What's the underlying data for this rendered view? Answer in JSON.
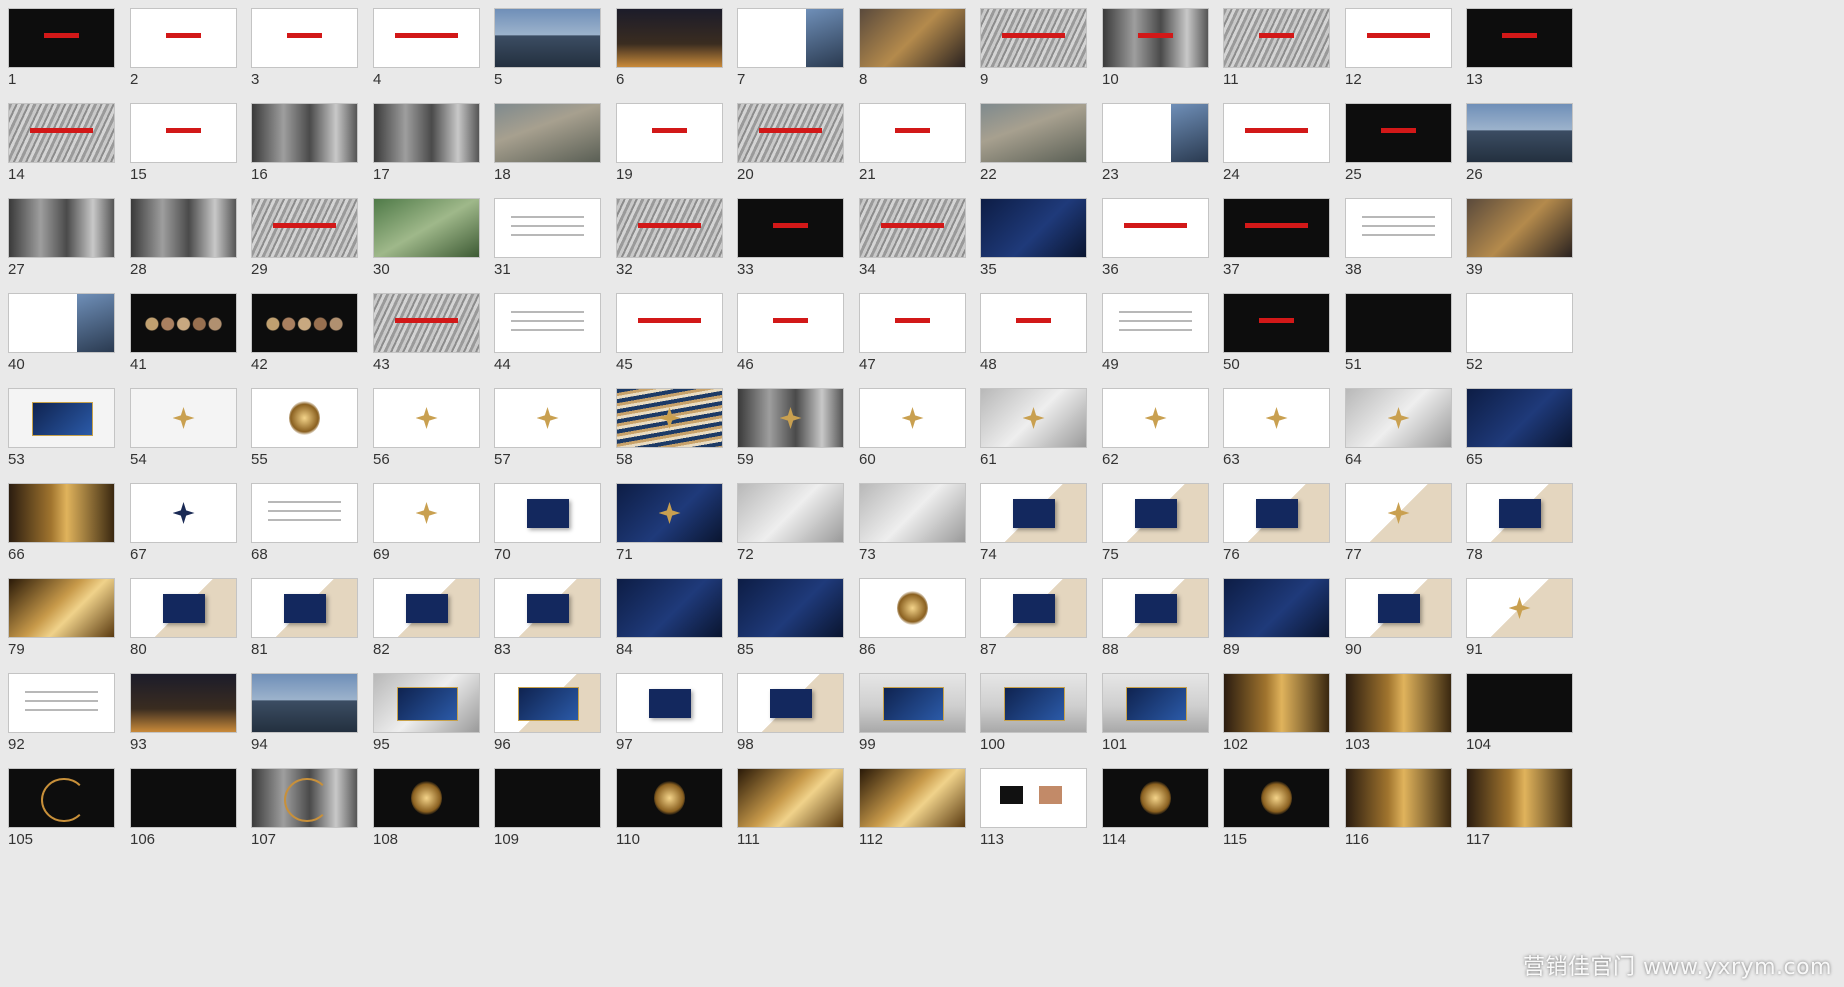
{
  "watermark": "营销佳官门 www.yxrym.com",
  "slides": [
    {
      "number": "1",
      "style": "black",
      "overlay": "redtext small"
    },
    {
      "number": "2",
      "style": "white",
      "overlay": "redtext small"
    },
    {
      "number": "3",
      "style": "white",
      "overlay": "redtext small"
    },
    {
      "number": "4",
      "style": "white",
      "overlay": "redtext"
    },
    {
      "number": "5",
      "style": "city",
      "overlay": ""
    },
    {
      "number": "6",
      "style": "night",
      "overlay": ""
    },
    {
      "number": "7",
      "style": "white",
      "overlay": "sidephoto"
    },
    {
      "number": "8",
      "style": "street",
      "overlay": ""
    },
    {
      "number": "9",
      "style": "marble",
      "overlay": "redtext"
    },
    {
      "number": "10",
      "style": "photo-bw",
      "overlay": "redtext small"
    },
    {
      "number": "11",
      "style": "marble",
      "overlay": "redtext small"
    },
    {
      "number": "12",
      "style": "white",
      "overlay": "redtext"
    },
    {
      "number": "13",
      "style": "black",
      "overlay": "redtext small"
    },
    {
      "number": "14",
      "style": "marble",
      "overlay": "redtext"
    },
    {
      "number": "15",
      "style": "white",
      "overlay": "redtext small"
    },
    {
      "number": "16",
      "style": "photo-bw",
      "overlay": ""
    },
    {
      "number": "17",
      "style": "photo-bw",
      "overlay": ""
    },
    {
      "number": "18",
      "style": "aerial",
      "overlay": ""
    },
    {
      "number": "19",
      "style": "white",
      "overlay": "redtext small"
    },
    {
      "number": "20",
      "style": "marble",
      "overlay": "redtext"
    },
    {
      "number": "21",
      "style": "white",
      "overlay": "redtext small"
    },
    {
      "number": "22",
      "style": "aerial",
      "overlay": ""
    },
    {
      "number": "23",
      "style": "white",
      "overlay": "sidephoto"
    },
    {
      "number": "24",
      "style": "white",
      "overlay": "redtext"
    },
    {
      "number": "25",
      "style": "black",
      "overlay": "redtext small"
    },
    {
      "number": "26",
      "style": "city",
      "overlay": ""
    },
    {
      "number": "27",
      "style": "photo-bw",
      "overlay": ""
    },
    {
      "number": "28",
      "style": "photo-bw",
      "overlay": ""
    },
    {
      "number": "29",
      "style": "marble",
      "overlay": "redtext"
    },
    {
      "number": "30",
      "style": "green",
      "overlay": ""
    },
    {
      "number": "31",
      "style": "white",
      "overlay": "bar"
    },
    {
      "number": "32",
      "style": "marble",
      "overlay": "redtext"
    },
    {
      "number": "33",
      "style": "black",
      "overlay": "redtext small"
    },
    {
      "number": "34",
      "style": "marble",
      "overlay": "redtext"
    },
    {
      "number": "35",
      "style": "navy",
      "overlay": ""
    },
    {
      "number": "36",
      "style": "white",
      "overlay": "redtext"
    },
    {
      "number": "37",
      "style": "black",
      "overlay": "redtext"
    },
    {
      "number": "38",
      "style": "white",
      "overlay": "bar"
    },
    {
      "number": "39",
      "style": "street",
      "overlay": ""
    },
    {
      "number": "40",
      "style": "white",
      "overlay": "sidephoto"
    },
    {
      "number": "41",
      "style": "black",
      "overlay": "circles"
    },
    {
      "number": "42",
      "style": "black",
      "overlay": "circles"
    },
    {
      "number": "43",
      "style": "marble",
      "overlay": "redtext"
    },
    {
      "number": "44",
      "style": "white",
      "overlay": "bar"
    },
    {
      "number": "45",
      "style": "white",
      "overlay": "redtext"
    },
    {
      "number": "46",
      "style": "white",
      "overlay": "redtext small"
    },
    {
      "number": "47",
      "style": "white",
      "overlay": "redtext small"
    },
    {
      "number": "48",
      "style": "white",
      "overlay": "redtext small"
    },
    {
      "number": "49",
      "style": "white",
      "overlay": "bar"
    },
    {
      "number": "50",
      "style": "black",
      "overlay": "redtext small"
    },
    {
      "number": "51",
      "style": "black",
      "overlay": ""
    },
    {
      "number": "52",
      "style": "white",
      "overlay": ""
    },
    {
      "number": "53",
      "style": "lightgrey",
      "overlay": "panel"
    },
    {
      "number": "54",
      "style": "lightgrey",
      "overlay": "star"
    },
    {
      "number": "55",
      "style": "white",
      "overlay": "gold-glow"
    },
    {
      "number": "56",
      "style": "white",
      "overlay": "star"
    },
    {
      "number": "57",
      "style": "white",
      "overlay": "star"
    },
    {
      "number": "58",
      "style": "waves",
      "overlay": "star"
    },
    {
      "number": "59",
      "style": "photo-bw",
      "overlay": "star"
    },
    {
      "number": "60",
      "style": "white",
      "overlay": "star"
    },
    {
      "number": "61",
      "style": "silver",
      "overlay": "star"
    },
    {
      "number": "62",
      "style": "white",
      "overlay": "star"
    },
    {
      "number": "63",
      "style": "white",
      "overlay": "star"
    },
    {
      "number": "64",
      "style": "silver",
      "overlay": "star"
    },
    {
      "number": "65",
      "style": "navy",
      "overlay": ""
    },
    {
      "number": "66",
      "style": "interior",
      "overlay": ""
    },
    {
      "number": "67",
      "style": "white",
      "overlay": "star dark"
    },
    {
      "number": "68",
      "style": "white",
      "overlay": "bar"
    },
    {
      "number": "69",
      "style": "white",
      "overlay": "star"
    },
    {
      "number": "70",
      "style": "white",
      "overlay": "card"
    },
    {
      "number": "71",
      "style": "navy",
      "overlay": "star"
    },
    {
      "number": "72",
      "style": "silver",
      "overlay": ""
    },
    {
      "number": "73",
      "style": "silver",
      "overlay": ""
    },
    {
      "number": "74",
      "style": "beige",
      "overlay": "card"
    },
    {
      "number": "75",
      "style": "beige",
      "overlay": "card"
    },
    {
      "number": "76",
      "style": "beige",
      "overlay": "card"
    },
    {
      "number": "77",
      "style": "beige",
      "overlay": "star"
    },
    {
      "number": "78",
      "style": "beige",
      "overlay": "card"
    },
    {
      "number": "79",
      "style": "gold",
      "overlay": ""
    },
    {
      "number": "80",
      "style": "beige",
      "overlay": "card"
    },
    {
      "number": "81",
      "style": "beige",
      "overlay": "card"
    },
    {
      "number": "82",
      "style": "beige",
      "overlay": "card"
    },
    {
      "number": "83",
      "style": "beige",
      "overlay": "card"
    },
    {
      "number": "84",
      "style": "navy",
      "overlay": ""
    },
    {
      "number": "85",
      "style": "navy",
      "overlay": ""
    },
    {
      "number": "86",
      "style": "white",
      "overlay": "gold-glow"
    },
    {
      "number": "87",
      "style": "beige",
      "overlay": "card"
    },
    {
      "number": "88",
      "style": "beige",
      "overlay": "card"
    },
    {
      "number": "89",
      "style": "navy",
      "overlay": ""
    },
    {
      "number": "90",
      "style": "beige",
      "overlay": "card"
    },
    {
      "number": "91",
      "style": "beige",
      "overlay": "star"
    },
    {
      "number": "92",
      "style": "white",
      "overlay": "bar"
    },
    {
      "number": "93",
      "style": "night",
      "overlay": ""
    },
    {
      "number": "94",
      "style": "city",
      "overlay": ""
    },
    {
      "number": "95",
      "style": "silver",
      "overlay": "panel"
    },
    {
      "number": "96",
      "style": "beige",
      "overlay": "panel"
    },
    {
      "number": "97",
      "style": "white",
      "overlay": "card"
    },
    {
      "number": "98",
      "style": "beige",
      "overlay": "card"
    },
    {
      "number": "99",
      "style": "gallery",
      "overlay": "panel"
    },
    {
      "number": "100",
      "style": "gallery",
      "overlay": "panel"
    },
    {
      "number": "101",
      "style": "gallery",
      "overlay": "panel"
    },
    {
      "number": "102",
      "style": "interior",
      "overlay": ""
    },
    {
      "number": "103",
      "style": "interior",
      "overlay": ""
    },
    {
      "number": "104",
      "style": "black",
      "overlay": ""
    },
    {
      "number": "105",
      "style": "black",
      "overlay": "spiral"
    },
    {
      "number": "106",
      "style": "black",
      "overlay": ""
    },
    {
      "number": "107",
      "style": "photo-bw",
      "overlay": "spiral"
    },
    {
      "number": "108",
      "style": "black",
      "overlay": "gold-glow"
    },
    {
      "number": "109",
      "style": "black",
      "overlay": ""
    },
    {
      "number": "110",
      "style": "black",
      "overlay": "gold-glow"
    },
    {
      "number": "111",
      "style": "gold",
      "overlay": ""
    },
    {
      "number": "112",
      "style": "gold",
      "overlay": ""
    },
    {
      "number": "113",
      "style": "white",
      "overlay": "swatches"
    },
    {
      "number": "114",
      "style": "black",
      "overlay": "gold-glow"
    },
    {
      "number": "115",
      "style": "black",
      "overlay": "gold-glow"
    },
    {
      "number": "116",
      "style": "interior",
      "overlay": ""
    },
    {
      "number": "117",
      "style": "interior",
      "overlay": ""
    }
  ]
}
